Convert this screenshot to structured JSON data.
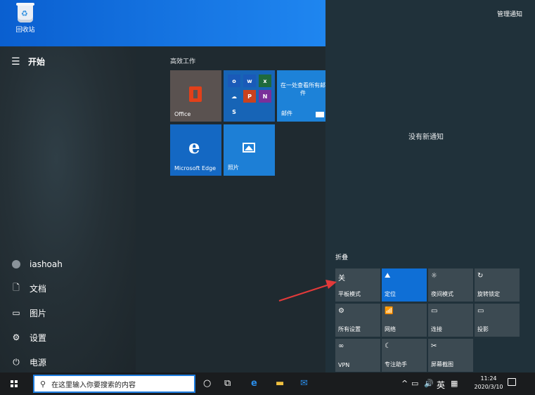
{
  "desktop": {
    "recycle_label": "回收站"
  },
  "start": {
    "title": "开始",
    "user": "iashoah",
    "items": [
      {
        "label": "文档",
        "icon": "document-icon"
      },
      {
        "label": "图片",
        "icon": "pictures-icon"
      },
      {
        "label": "设置",
        "icon": "gear-icon"
      },
      {
        "label": "电源",
        "icon": "power-icon"
      }
    ],
    "group_title": "高效工作",
    "tiles": {
      "office": "Office",
      "mail_text": "在一处查看所有邮件",
      "mail": "邮件",
      "edge": "Microsoft Edge",
      "photos": "照片"
    }
  },
  "action_center": {
    "manage": "管理通知",
    "no_notifications": "没有新通知",
    "collapse": "折叠",
    "quick_actions": [
      {
        "label": "平板模式",
        "top": "关",
        "active": false
      },
      {
        "label": "定位",
        "active": true
      },
      {
        "label": "夜间模式",
        "active": false
      },
      {
        "label": "旋转锁定",
        "active": false
      },
      {
        "label": "所有设置",
        "active": false
      },
      {
        "label": "网络",
        "active": false
      },
      {
        "label": "连接",
        "active": false
      },
      {
        "label": "投影",
        "active": false
      },
      {
        "label": "VPN",
        "active": false
      },
      {
        "label": "专注助手",
        "active": false
      },
      {
        "label": "屏幕截图",
        "active": false
      }
    ]
  },
  "taskbar": {
    "search_placeholder": "在这里输入你要搜索的内容",
    "ime": "英",
    "time": "11:24",
    "date": "2020/3/10"
  },
  "colors": {
    "accent": "#0f6fd6",
    "taskbar": "#1a1c1e",
    "annotation": "#e23a3a"
  }
}
